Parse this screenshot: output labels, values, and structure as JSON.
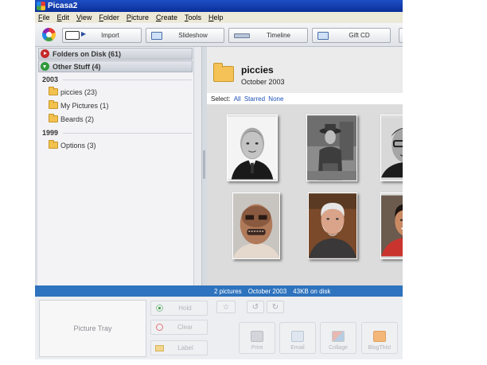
{
  "window": {
    "title": "Picasa2"
  },
  "menu": [
    "File",
    "Edit",
    "View",
    "Folder",
    "Picture",
    "Create",
    "Tools",
    "Help"
  ],
  "toolbar": {
    "import": "Import",
    "slideshow": "Slideshow",
    "timeline": "Timeline",
    "giftcd": "Gift CD"
  },
  "sidebar": {
    "folders_on_disk": "Folders on Disk (61)",
    "other_stuff": "Other Stuff (4)",
    "groups": [
      {
        "year": "2003",
        "items": [
          "piccies (23)",
          "My Pictures (1)",
          "Beards (2)"
        ]
      },
      {
        "year": "1999",
        "items": [
          "Options (3)"
        ]
      }
    ]
  },
  "folder": {
    "title": "piccies",
    "date": "October 2003",
    "select_label": "Select:",
    "select_all": "All",
    "select_starred": "Starred",
    "select_none": "None"
  },
  "status": {
    "pictures": "2 pictures",
    "date": "October 2003",
    "size": "43KB on disk"
  },
  "tray": {
    "picture_tray": "Picture Tray",
    "hold": "Hold",
    "clear": "Clear",
    "label": "Label",
    "actions": [
      "Print",
      "Email",
      "Collage",
      "BlogThis!"
    ]
  },
  "colors": {
    "titlebar": "#0a2f99",
    "statusbar": "#2e73bd",
    "link": "#1f4fb8"
  }
}
